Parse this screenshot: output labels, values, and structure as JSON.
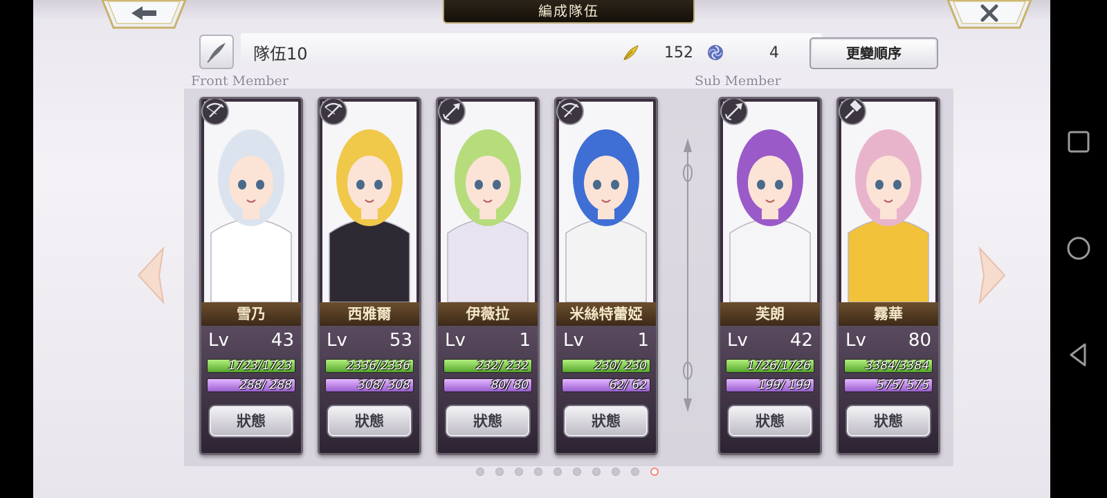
{
  "header": {
    "title": "編成隊伍"
  },
  "team": {
    "name": "隊伍10",
    "feather_count": "152",
    "orb_count": "4",
    "reorder_label": "更變順序"
  },
  "sections": {
    "front": "Front Member",
    "sub": "Sub Member"
  },
  "members": [
    {
      "name": "雪乃",
      "lv_label": "Lv",
      "lv": "43",
      "hp": "1723/1723",
      "mp": "288/ 288",
      "hp_pct": 1.0,
      "mp_pct": 1.0,
      "class_icon": "crossbow-icon",
      "status_label": "狀態",
      "hair": "#dbe4ee",
      "outfit": "#ffffff"
    },
    {
      "name": "西雅爾",
      "lv_label": "Lv",
      "lv": "53",
      "hp": "2336/2336",
      "mp": "308/ 308",
      "hp_pct": 1.0,
      "mp_pct": 1.0,
      "class_icon": "crossbow-icon",
      "status_label": "狀態",
      "hair": "#f0c84a",
      "outfit": "#2e2a34"
    },
    {
      "name": "伊薇拉",
      "lv_label": "Lv",
      "lv": "1",
      "hp": "232/ 232",
      "mp": "80/ 80",
      "hp_pct": 1.0,
      "mp_pct": 1.0,
      "class_icon": "arrow-icon",
      "status_label": "狀態",
      "hair": "#b6dc7c",
      "outfit": "#e8e3f0"
    },
    {
      "name": "米絲特蕾婭",
      "lv_label": "Lv",
      "lv": "1",
      "hp": "230/ 230",
      "mp": "62/ 62",
      "hp_pct": 1.0,
      "mp_pct": 1.0,
      "class_icon": "crossbow-icon",
      "status_label": "狀態",
      "hair": "#3f6fd4",
      "outfit": "#f3f3f3"
    },
    {
      "name": "芙朗",
      "lv_label": "Lv",
      "lv": "42",
      "hp": "1726/1726",
      "mp": "199/ 199",
      "hp_pct": 1.0,
      "mp_pct": 1.0,
      "class_icon": "arrow-icon",
      "status_label": "狀態",
      "hair": "#9a5ac8",
      "outfit": "#f5f5f7"
    },
    {
      "name": "霧華",
      "lv_label": "Lv",
      "lv": "80",
      "hp": "3384/3384",
      "mp": "575/ 575",
      "hp_pct": 1.0,
      "mp_pct": 1.0,
      "class_icon": "hammer-icon",
      "status_label": "狀態",
      "hair": "#e8b4cc",
      "outfit": "#f2c23a"
    }
  ],
  "pagination": {
    "total": 10,
    "current": 10
  },
  "colors": {
    "accent_active_dot": "#f08a7a",
    "hp": "#6cc23a",
    "mp": "#b27ee0"
  }
}
